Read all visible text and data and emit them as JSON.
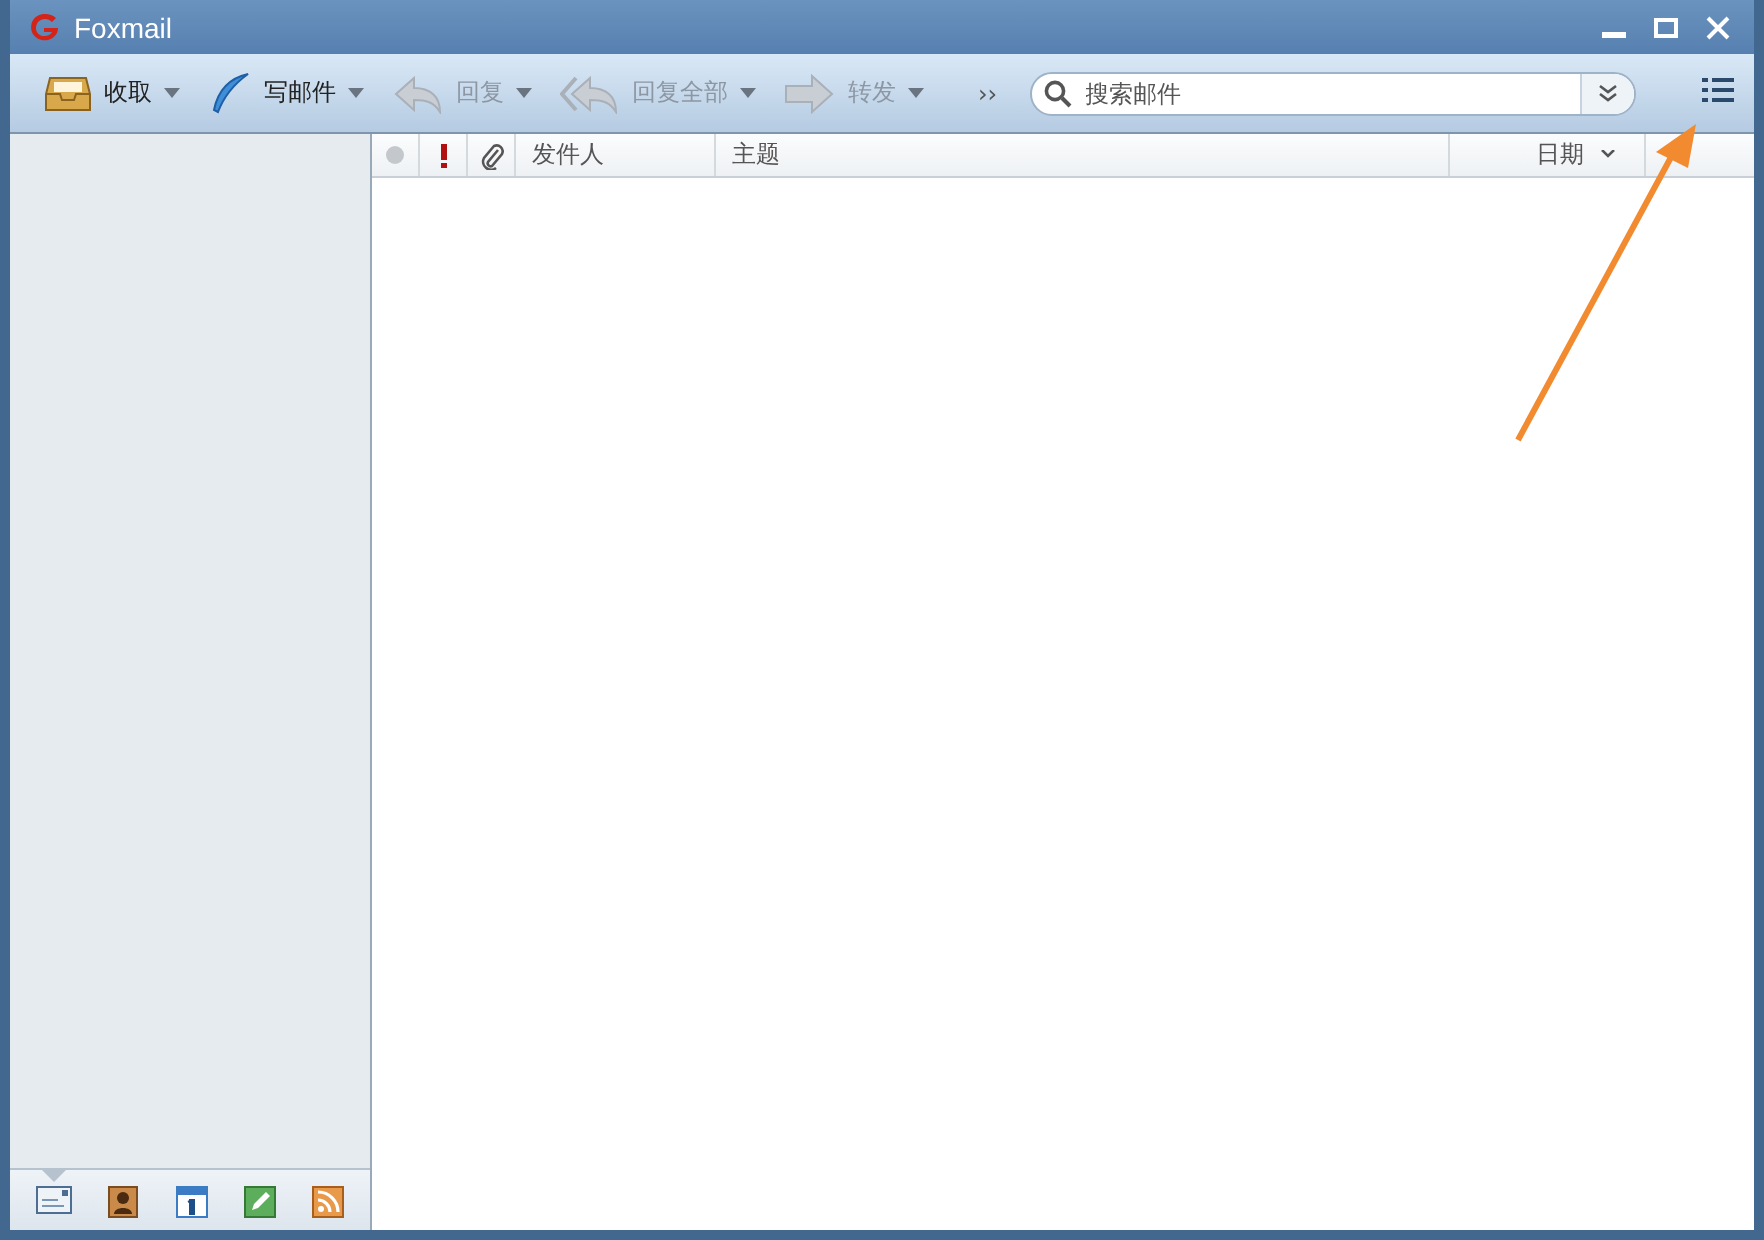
{
  "window": {
    "title": "Foxmail"
  },
  "toolbar": {
    "items": [
      {
        "kind": "inbox",
        "label": "收取",
        "disabled": false,
        "menu": true
      },
      {
        "kind": "feather",
        "label": "写邮件",
        "disabled": false,
        "menu": true
      },
      {
        "kind": "reply",
        "label": "回复",
        "disabled": true,
        "menu": true
      },
      {
        "kind": "replyall",
        "label": "回复全部",
        "disabled": true,
        "menu": true
      },
      {
        "kind": "forward",
        "label": "转发",
        "disabled": true,
        "menu": true
      }
    ],
    "more": "››",
    "search": {
      "placeholder": "搜索邮件"
    }
  },
  "message_list": {
    "columns": [
      {
        "kind": "read"
      },
      {
        "kind": "flag"
      },
      {
        "kind": "attach"
      },
      {
        "kind": "text",
        "label": "发件人"
      },
      {
        "kind": "text",
        "label": "主题"
      },
      {
        "kind": "sort",
        "label": "日期"
      },
      {
        "kind": "blank"
      }
    ]
  },
  "bottom_nav": [
    {
      "kind": "mail",
      "selected": true
    },
    {
      "kind": "contacts",
      "selected": false
    },
    {
      "kind": "calendar",
      "selected": false
    },
    {
      "kind": "notes",
      "selected": false
    },
    {
      "kind": "feed",
      "selected": false
    }
  ]
}
